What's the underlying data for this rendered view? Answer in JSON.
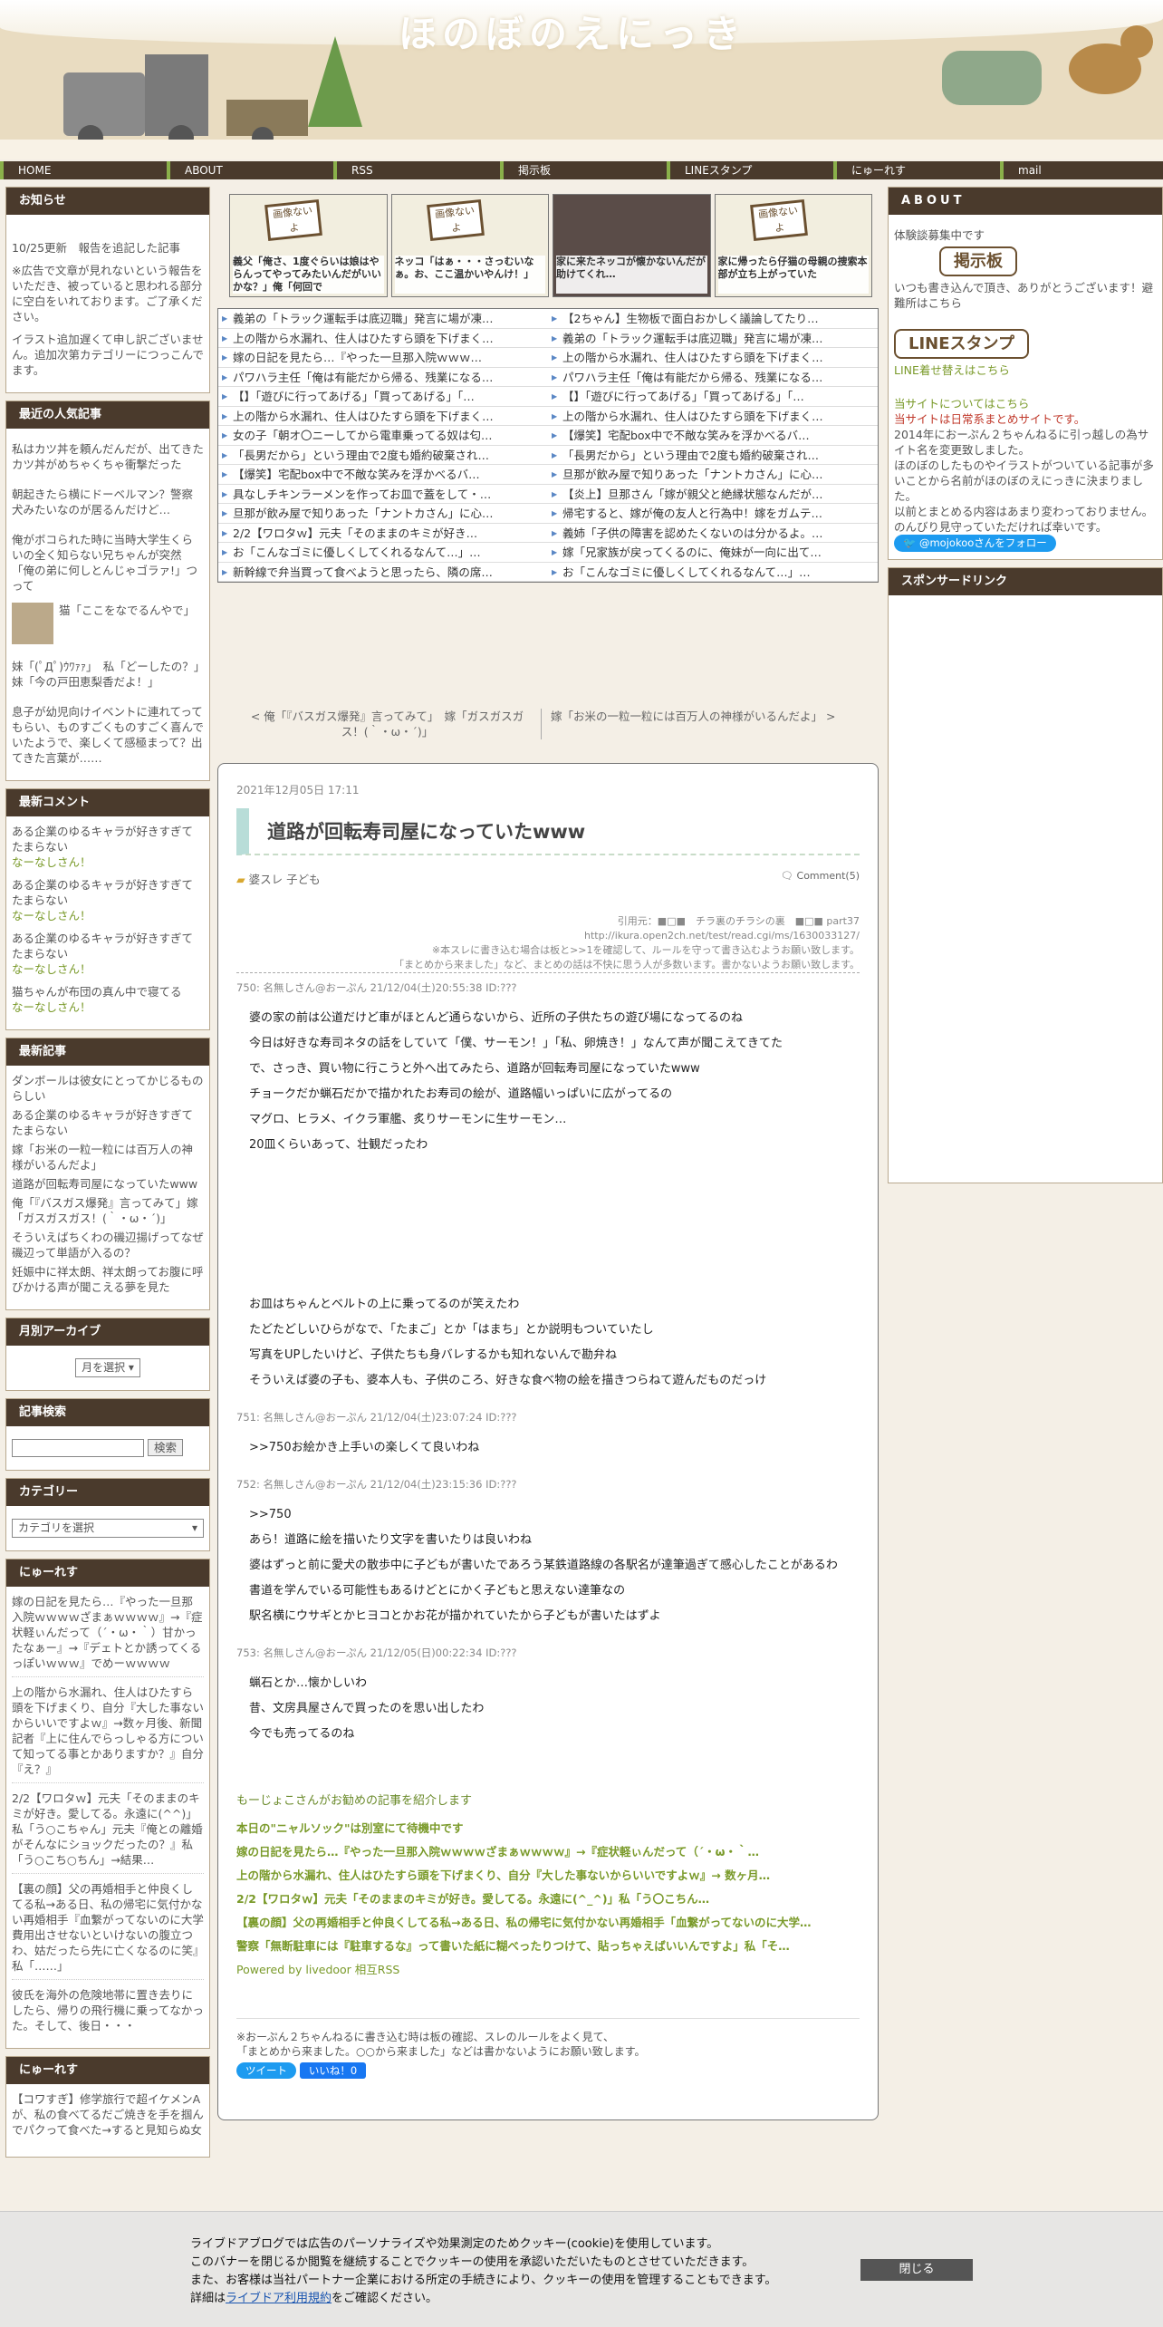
{
  "header": {
    "title": "ほのぼのえにっき"
  },
  "nav": [
    "HOME",
    "ABOUT",
    "RSS",
    "掲示板",
    "LINEスタンプ",
    "にゅーれす",
    "mail"
  ],
  "notice": {
    "head": "お知らせ",
    "p1": "10/25更新　報告を追記した記事",
    "p2": "※広告で文章が見れないという報告をいただき、被っていると思われる部分に空白をいれております。ご了承ください。",
    "p3": "イラスト追加遅くて申し訳ございません。追加次第カテゴリーにつっこんでます。"
  },
  "popular": {
    "head": "最近の人気記事",
    "items": [
      "私はカツ丼を頼んだんだが、出てきたカツ丼がめちゃくちゃ衝撃だった",
      "朝起きたら横にドーベルマン？警察犬みたいなのが居るんだけど…",
      "俺がボコられた時に当時大学生くらいの全く知らない兄ちゃんが突然「俺の弟に何しとんじゃゴラァ!」つって",
      "猫「ここをなでるんやで」",
      "妹「(ﾟДﾟ)ｳﾜｧｧ」　私「どーしたの？」　妹「今の戸田恵梨香だよ！」",
      "息子が幼児向けイベントに連れてってもらい、ものすごくものすごく喜んでいたようで、楽しくて感極まって？出てきた言葉が……"
    ]
  },
  "comments": {
    "head": "最新コメント",
    "items": [
      {
        "t": "ある企業のゆるキャラが好きすぎてたまらない",
        "u": "なーなしさん！"
      },
      {
        "t": "ある企業のゆるキャラが好きすぎてたまらない",
        "u": "なーなしさん！"
      },
      {
        "t": "ある企業のゆるキャラが好きすぎてたまらない",
        "u": "なーなしさん！"
      },
      {
        "t": "猫ちゃんが布団の真ん中で寝てる",
        "u": "なーなしさん！"
      }
    ]
  },
  "latest": {
    "head": "最新記事",
    "items": [
      "ダンボールは彼女にとってかじるものらしい",
      "ある企業のゆるキャラが好きすぎてたまらない",
      "嫁「お米の一粒一粒には百万人の神様がいるんだよ」",
      "道路が回転寿司屋になっていたwww",
      "俺「『バスガス爆発』言ってみて」嫁「ガスガスガス！(｀・ω・´)」",
      "そういえばちくわの磯辺揚げってなぜ磯辺って単語が入るの？",
      "妊娠中に祥太朗、祥太朗ってお腹に呼びかける声が聞こえる夢を見た"
    ]
  },
  "archive": {
    "head": "月別アーカイブ",
    "select": "月を選択"
  },
  "search": {
    "head": "記事検索",
    "btn": "検索"
  },
  "category": {
    "head": "カテゴリー",
    "select": "カテゴリを選択"
  },
  "newres": {
    "head": "にゅーれす",
    "items": [
      "嫁の日記を見たら…『やった一旦那入院ｗｗｗｗざまぁｗｗｗｗ』→『症状軽ぃんだって（´・ω・｀）甘かったなぁー』→『デェトとか誘ってくるっぽいｗｗｗ』でめーｗｗｗｗ",
      "上の階から水漏れ、住人はひたすら頭を下げまくり、自分『大した事ないからいいですよｗ』→数ヶ月後、新聞記者『上に住んでらっしゃる方について知ってる事とかありますか？』自分『え？』",
      "2/2【ワロタｗ】元夫「そのままのキミが好き。愛してる。永遠に(^^)」私「う○こちゃん」元夫『俺との離婚がそんなにショックだったの？』私「う○こち○ちん」→結果…",
      "【裏の顔】父の再婚相手と仲良くしてる私→ある日、私の帰宅に気付かない再婚相手『血繋がってないのに大学費用出させないといけないの腹立つわ、姑だったら先に亡くなるのに笑』私「……」",
      "彼氏を海外の危険地帯に置き去りにしたら、帰りの飛行機に乗ってなかった。そして、後日・・・"
    ]
  },
  "newres2": {
    "head": "にゅーれす",
    "first": "【コワすぎ】修学旅行で超イケメンAが、私の食べてるだご焼きを手を掴んでパクって食べた→すると見知らぬ女"
  },
  "thumbs": [
    {
      "ph": "画像ないよ",
      "cap": "義父「俺さ、1度ぐらいは娘はやらんってやってみたいんだがいいかな？」俺「何回で"
    },
    {
      "ph": "画像ないよ",
      "cap": "ネッコ「はぁ・・・さっむいなぁ。お、ここ温かいやんけ！」"
    },
    {
      "ph": "",
      "cap": "家に来たネッコが懐かないんだが助けてくれ…"
    },
    {
      "ph": "画像ないよ",
      "cap": "家に帰ったら仔猫の母親の捜索本部が立ち上がっていた"
    }
  ],
  "links": [
    [
      "義弟の「トラック運転手は底辺職」発言に場が凍…",
      "【2ちゃん】生物板で面白おかしく議論してたり…"
    ],
    [
      "上の階から水漏れ、住人はひたすら頭を下げまく…",
      "義弟の「トラック運転手は底辺職」発言に場が凍…"
    ],
    [
      "嫁の日記を見たら…『やった一旦那入院ｗｗｗ…",
      "上の階から水漏れ、住人はひたすら頭を下げまく…"
    ],
    [
      "パワハラ主任「俺は有能だから帰る、残業になる…",
      "パワハラ主任「俺は有能だから帰る、残業になる…"
    ],
    [
      "【】「遊びに行ってあげる」「買ってあげる」「…",
      "【】「遊びに行ってあげる」「買ってあげる」「…"
    ],
    [
      "上の階から水漏れ、住人はひたすら頭を下げまく…",
      "上の階から水漏れ、住人はひたすら頭を下げまく…"
    ],
    [
      "女の子「朝オ〇ニーしてから電車乗ってる奴は匂…",
      "【爆笑】宅配box中で不敵な笑みを浮かべるバ…"
    ],
    [
      "「長男だから」という理由で2度も婚約破棄され…",
      "「長男だから」という理由で2度も婚約破棄され…"
    ],
    [
      "【爆笑】宅配box中で不敵な笑みを浮かべるバ…",
      "旦那が飲み屋で知りあった「ナントカさん」に心…"
    ],
    [
      "具なしチキンラーメンを作ってお皿で蓋をして・…",
      "【炎上】旦那さん「嫁が親父と絶縁状態なんだが…"
    ],
    [
      "旦那が飲み屋で知りあった「ナントカさん」に心…",
      "帰宅すると、嫁が俺の友人と行為中！嫁をガムテ…"
    ],
    [
      "2/2【ワロタｗ】元夫「そのままのキミが好き…",
      "義姉「子供の障害を認めたくないのは分かるよ。…"
    ],
    [
      "お「こんなゴミに優しくしてくれるなんて…」…",
      "嫁「兄家族が戻ってくるのに、俺妹が一向に出て…"
    ],
    [
      "新幹線で弁当買って食べようと思ったら、隣の席…",
      "お「こんなゴミに優しくしてくれるなんて…」…"
    ]
  ],
  "pager": {
    "prev": "< 俺「『バスガス爆発』言ってみて」　嫁「ガスガスガス！(｀・ω・´)」",
    "next": "嫁「お米の一粒一粒には百万人の神様がいるんだよ」 >"
  },
  "article": {
    "date": "2021年12月05日 17:11",
    "title": "道路が回転寿司屋になっていたwww",
    "cats": "婆スレ 子ども",
    "comments": "Comment(5)",
    "src1": "引用元：■□■　チラ裏のチラシの裏　■□■ part37",
    "src2": "http://ikura.open2ch.net/test/read.cgi/ms/1630033127/",
    "src3": "※本スレに書き込む場合は板と>>1を確認して、ルールを守って書き込むようお願い致します。",
    "src4": "「まとめから来ました」など、まとめの話は不快に思う人が多数います。書かないようお願い致します。",
    "res": [
      {
        "h": "750: 名無しさん@おーぷん 21/12/04(土)20:55:38 ID:???",
        "lines": [
          "婆の家の前は公道だけど車がほとんど通らないから、近所の子供たちの遊び場になってるのね",
          "今日は好きな寿司ネタの話をしていて「僕、サーモン！」「私、卵焼き！」なんて声が聞こえてきてた",
          "で、さっき、買い物に行こうと外へ出てみたら、道路が回転寿司屋になっていたwww",
          "チョークだか蝋石だかで描かれたお寿司の絵が、道路幅いっぱいに広がってるの",
          "マグロ、ヒラメ、イクラ軍艦、炙りサーモンに生サーモン…",
          "20皿くらいあって、壮観だったわ"
        ],
        "lines2": [
          "お皿はちゃんとベルトの上に乗ってるのが笑えたわ",
          "たどたどしいひらがなで、「たまご」とか「はまち」とか説明もついていたし",
          "写真をUPしたいけど、子供たちも身バレするかも知れないんで勘弁ね",
          "そういえば婆の子も、婆本人も、子供のころ、好きな食べ物の絵を描きつらねて遊んだものだっけ"
        ]
      },
      {
        "h": "751: 名無しさん@おーぷん 21/12/04(土)23:07:24 ID:???",
        "lines": [
          ">>750お絵かき上手いの楽しくて良いわね"
        ]
      },
      {
        "h": "752: 名無しさん@おーぷん 21/12/04(土)23:15:36 ID:???",
        "lines": [
          ">>750",
          "あら！道路に絵を描いたり文字を書いたりは良いわね",
          "婆はずっと前に愛犬の散歩中に子どもが書いたであろう某鉄道路線の各駅名が達筆過ぎて感心したことがあるわ",
          "書道を学んでいる可能性もあるけどとにかく子どもと思えない達筆なの",
          "駅名横にウサギとかヒヨコとかお花が描かれていたから子どもが書いたはずよ"
        ]
      },
      {
        "h": "753: 名無しさん@おーぷん 21/12/05(日)00:22:34 ID:???",
        "lines": [
          "蝋石とか…懐かしいわ",
          "昔、文房具屋さんで買ったのを思い出したわ",
          "今でも売ってるのね"
        ]
      }
    ],
    "rec": {
      "head": "もーじょこさんがお勧めの記事を紹介します",
      "items": [
        "本日の\"ニャルソック\"は別室にて待機中です",
        "嫁の日記を見たら…『やった一旦那入院ｗｗｗｗざまぁｗｗｗｗ』→『症状軽ぃんだって（´・ω・｀…",
        "上の階から水漏れ、住人はひたすら頭を下げまくり、自分『大した事ないからいいですよｗ』→ 数ヶ月…",
        "2/2【ワロタｗ】元夫「そのままのキミが好き。愛してる。永遠に(^_^)」私「う〇こちん…",
        "【裏の顔】父の再婚相手と仲良くしてる私→ある日、私の帰宅に気付かない再婚相手「血繋がってないのに大学…",
        "警察「無断駐車には『駐車するな』って書いた紙に糊べったりつけて、貼っちゃえばいいんですよ」私「そ…"
      ],
      "foot": "Powered by livedoor 相互RSS"
    },
    "note1": "※おーぷん２ちゃんねるに書き込む時は板の確認、スレのルールをよく見て、",
    "note2": "「まとめから来ました。○○から来ました」などは書かないようにお願い致します。",
    "tweet": "ツイート",
    "like": "いいね！0"
  },
  "about": {
    "head": "ABOUT",
    "l1": "体験談募集中です",
    "bbs": "掲示板",
    "l2": "いつも書き込んで頂き、ありがとうございます！避難所はこちら",
    "line": "LINEスタンプ",
    "l3": "LINE着せ替えはこちら",
    "l4": "当サイトについてはこちら",
    "l5": "当サイトは日常系まとめサイトです。",
    "l6": "2014年におーぷん２ちゃんねるに引っ越しの為サイト名を変更致しました。",
    "l7": "ほのぼのしたものやイラストがついている記事が多いことから名前がほのぼのえにっきに決まりました。",
    "l8": "以前とまとめる内容はあまり変わっておりません。",
    "l9": "のんびり見守っていただければ幸いです。",
    "follow": "@mojokooさんをフォロー"
  },
  "sponsor": {
    "head": "スポンサードリンク"
  },
  "cookie": {
    "l1": "ライブドアブログでは広告のパーソナライズや効果測定のためクッキー(cookie)を使用しています。",
    "l2": "このバナーを閉じるか閲覧を継続することでクッキーの使用を承認いただいたものとさせていただきます。",
    "l3": "また、お客様は当社パートナー企業における所定の手続きにより、クッキーの使用を管理することもできます。",
    "l4a": "詳細は",
    "l4b": "ライブドア利用規約",
    "l4c": "をご確認ください。",
    "close": "閉じる"
  }
}
